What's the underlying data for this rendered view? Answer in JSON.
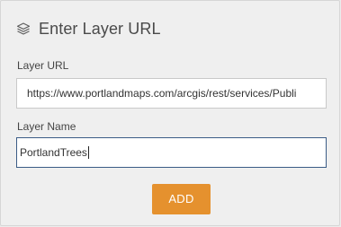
{
  "header": {
    "icon": "layers-icon",
    "title": "Enter Layer URL"
  },
  "form": {
    "url_label": "Layer URL",
    "url_value": "https://www.portlandmaps.com/arcgis/rest/services/Publi",
    "name_label": "Layer Name",
    "name_value": "PortlandTrees",
    "add_label": "ADD"
  },
  "colors": {
    "accent": "#e5912e",
    "focus_border": "#3b5c86",
    "panel_bg": "#efefef"
  }
}
